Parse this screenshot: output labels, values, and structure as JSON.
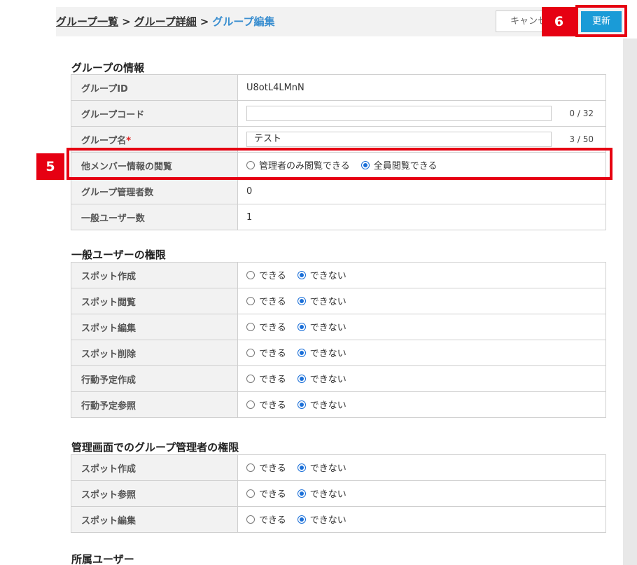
{
  "breadcrumb": {
    "item1": "グループ一覧",
    "item2": "グループ詳細",
    "current": "グループ編集",
    "separator": ">"
  },
  "actions": {
    "cancel_label": "キャンセル",
    "update_label": "更新"
  },
  "annotations": {
    "marker_5": "5",
    "marker_6": "6"
  },
  "group_info": {
    "title": "グループの情報",
    "rows": {
      "id": {
        "label": "グループID",
        "value": "U8otL4LMnN"
      },
      "code": {
        "label": "グループコード",
        "value": "",
        "counter": "0 / 32"
      },
      "name": {
        "label": "グループ名",
        "required_mark": "*",
        "value": "テスト",
        "counter": "3 / 50"
      },
      "member_view": {
        "label": "他メンバー情報の閲覧",
        "option1": "管理者のみ閲覧できる",
        "option2": "全員閲覧できる",
        "selected": "全員閲覧できる"
      },
      "admin_count": {
        "label": "グループ管理者数",
        "value": "0"
      },
      "user_count": {
        "label": "一般ユーザー数",
        "value": "1"
      }
    }
  },
  "options": {
    "yes": "できる",
    "no": "できない"
  },
  "user_perms": {
    "title": "一般ユーザーの権限",
    "rows": [
      {
        "label": "スポット作成",
        "selected": "できない"
      },
      {
        "label": "スポット閲覧",
        "selected": "できない"
      },
      {
        "label": "スポット編集",
        "selected": "できない"
      },
      {
        "label": "スポット削除",
        "selected": "できない"
      },
      {
        "label": "行動予定作成",
        "selected": "できない"
      },
      {
        "label": "行動予定参照",
        "selected": "できない"
      }
    ]
  },
  "admin_perms": {
    "title": "管理画面でのグループ管理者の権限",
    "rows": [
      {
        "label": "スポット作成",
        "selected": "できない"
      },
      {
        "label": "スポット参照",
        "selected": "できない"
      },
      {
        "label": "スポット編集",
        "selected": "できない"
      }
    ]
  },
  "members": {
    "title": "所属ユーザー"
  },
  "colors": {
    "accent": "#1a9bd7",
    "annotation": "#e60012",
    "link_current": "#3b8fd0"
  }
}
